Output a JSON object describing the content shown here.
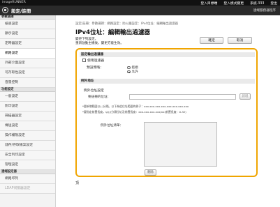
{
  "header": {
    "brand": "imageRUNNER",
    "links": [
      "登入目標端",
      "登入模式變更",
      "系統.333",
      "登出"
    ],
    "app_title": "設定/註冊",
    "admin_link": "遠端服務器程序"
  },
  "sidebar": {
    "groups": [
      {
        "label": "參數選擇",
        "items": [
          "紙張設定",
          "顯示設定",
          "定時器設定",
          "網路設定",
          "外部介面設定",
          "可存取性設定",
          "音量控制"
        ]
      },
      {
        "label": "功能設定",
        "items": [
          "一般設定",
          "影印設定",
          "掃描器設定",
          "傳送設定",
          "操作權限設定",
          "儲存/存取檔案設定",
          "安全列印設定",
          "管理設定"
        ]
      },
      {
        "label": "遠端設定器",
        "items": [
          "網路印列",
          "LDAP伺服器設定"
        ]
      }
    ],
    "active_item": "網路設定"
  },
  "main": {
    "breadcrumb": "設定/註冊：參數選擇：網路設定：防火牆設定：IPv4位址：編輯輸出過濾器",
    "title": "IPv4位址：編輯輸出過濾器",
    "note_line1": "變更下列設定。",
    "note_line2": "重新啟動主機後，變更方能生效。",
    "ok_label": "確定",
    "cancel_label": "取消"
  },
  "filter": {
    "section_title": "設定輸出過濾器",
    "use_filter_label": "使用過濾器",
    "policy_label": "預設策略：",
    "reject_label": "拒絕",
    "allow_label": "允許",
    "selected_policy": "allow"
  },
  "exceptions": {
    "section_title": "例外地址",
    "subheading": "例外位址設定",
    "register_label": "要註冊的位址：",
    "add_label": "新增",
    "hint1": "*要新增範圍以(-)分隔。以下為從位址範圍的例子：xxx.xxx.xxx.xxx-xxx.xxx.xxx.xxx",
    "hint2": "*要指定前置長度，以(/)分隔位址及前置長度：xxx.xxx.xxx.xxx/xx(前置長度：0-32)",
    "list_label": "例外位址清單：",
    "delete_label": "刪除"
  },
  "footer": {
    "top_label": "頂"
  }
}
